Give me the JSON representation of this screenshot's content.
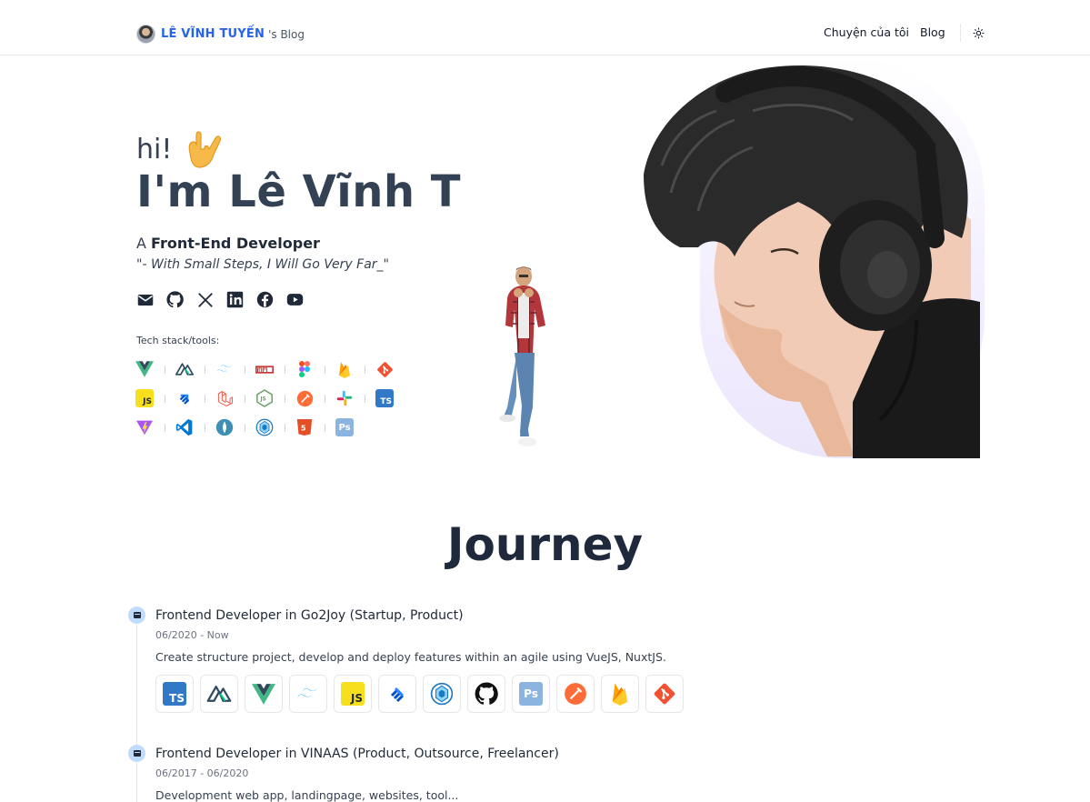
{
  "header": {
    "brand_name": "LÊ VĨNH TUYẾN",
    "brand_suffix": "'s Blog",
    "nav": [
      "Chuyện của tôi",
      "Blog"
    ]
  },
  "hero": {
    "greeting": "hi!",
    "headline": "I'm Lê Vĩnh T",
    "role_prefix": "A",
    "role": "Front-End Developer",
    "quote": "\"- With Small Steps, I Will Go Very Far_\"",
    "socials": [
      "mail-icon",
      "github-icon",
      "x-icon",
      "linkedin-icon",
      "facebook-icon",
      "youtube-icon"
    ],
    "stack_label": "Tech stack/tools:",
    "stack": [
      [
        "vue",
        "nuxt",
        "tailwind",
        "npm",
        "figma",
        "firebase",
        "git"
      ],
      [
        "js",
        "jira",
        "laravel",
        "nodejs",
        "postman",
        "slack",
        "ts"
      ],
      [
        "vite",
        "vscode",
        "mongo",
        "webpack",
        "html5",
        "ps"
      ]
    ]
  },
  "journey": {
    "title": "Journey",
    "jobs": [
      {
        "title": "Frontend Developer in Go2Joy (Startup, Product)",
        "date": "06/2020 - Now",
        "desc": "Create structure project, develop and deploy features within an agile using VueJS, NuxtJS.",
        "icons": [
          "ts",
          "nuxt",
          "vue",
          "tailwind",
          "js",
          "jira",
          "webpack",
          "github",
          "ps",
          "postman",
          "firebase",
          "git"
        ]
      },
      {
        "title": "Frontend Developer in VINAAS (Product, Outsource, Freelancer)",
        "date": "06/2017 - 06/2020",
        "desc": "Development web app, landingpage, websites, tool..."
      }
    ]
  },
  "colors": {
    "brand": "#2563eb",
    "heading": "#334155",
    "timeline_dot": "#bfdbfe"
  }
}
